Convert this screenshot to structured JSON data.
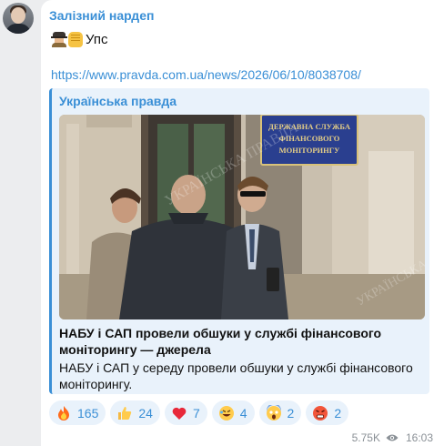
{
  "post": {
    "author": "Залізний нардеп",
    "text": "Упс",
    "link": "https://www.pravda.com.ua/news/2026/06/10/8038708/"
  },
  "preview": {
    "site_name": "Українська правда",
    "title": "НАБУ і САП провели обшуки у службі фінансового моніторингу — джерела",
    "description": "НАБУ і САП у середу провели обшуки у службі фінансового моніторингу.",
    "photo_sign": [
      "ДЕРЖАВНА СЛУЖБА",
      "ФІНАНСОВОГО",
      "МОНІТОРИНГУ"
    ]
  },
  "reactions": [
    {
      "icon": "fire-icon",
      "count": "165"
    },
    {
      "icon": "thumbs-up-icon",
      "count": "24"
    },
    {
      "icon": "heart-icon",
      "count": "7"
    },
    {
      "icon": "rofl-icon",
      "count": "4"
    },
    {
      "icon": "scream-icon",
      "count": "2"
    },
    {
      "icon": "angry-face-icon",
      "count": "2"
    }
  ],
  "meta": {
    "views": "5.75K",
    "time": "16:03"
  },
  "colors": {
    "accent": "#3a8fd6",
    "background": "#ecedef",
    "preview_bg": "#e9f2fb"
  }
}
